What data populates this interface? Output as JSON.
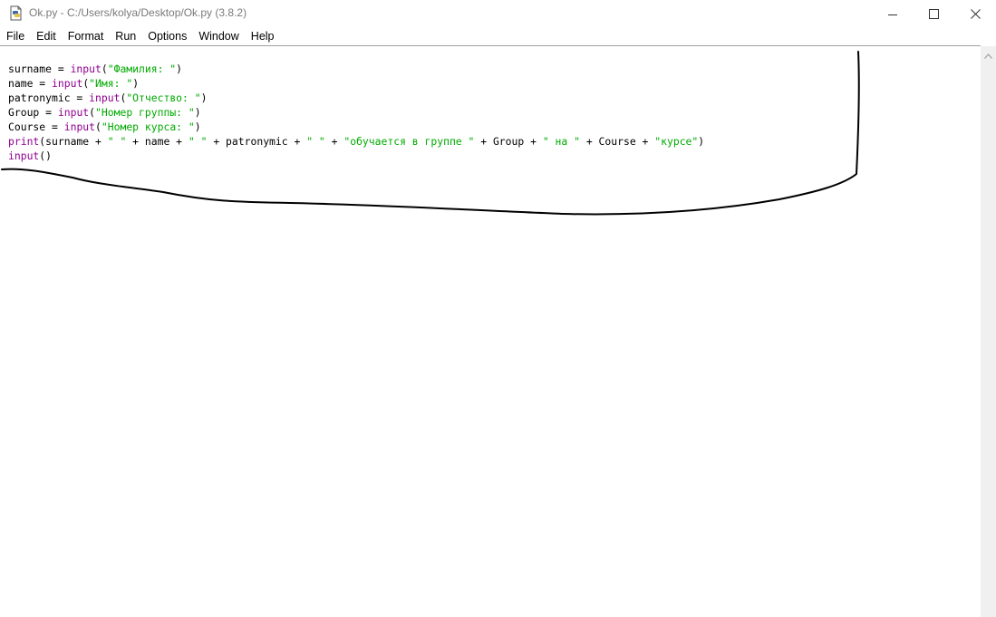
{
  "window": {
    "title": "Ok.py - C:/Users/kolya/Desktop/Ok.py (3.8.2)"
  },
  "icons": {
    "app": "python-file-icon",
    "minimize": "minimize-icon",
    "maximize": "maximize-icon",
    "close": "close-icon",
    "scroll_up": "arrow-up-icon"
  },
  "menu": {
    "items": [
      {
        "label": "File"
      },
      {
        "label": "Edit"
      },
      {
        "label": "Format"
      },
      {
        "label": "Run"
      },
      {
        "label": "Options"
      },
      {
        "label": "Window"
      },
      {
        "label": "Help"
      }
    ]
  },
  "code": {
    "lines": [
      [
        {
          "t": "surname = ",
          "c": "plain"
        },
        {
          "t": "input",
          "c": "kw"
        },
        {
          "t": "(",
          "c": "plain"
        },
        {
          "t": "\"Фамилия: \"",
          "c": "str"
        },
        {
          "t": ")",
          "c": "plain"
        }
      ],
      [
        {
          "t": "name = ",
          "c": "plain"
        },
        {
          "t": "input",
          "c": "kw"
        },
        {
          "t": "(",
          "c": "plain"
        },
        {
          "t": "\"Имя: \"",
          "c": "str"
        },
        {
          "t": ")",
          "c": "plain"
        }
      ],
      [
        {
          "t": "patronymic = ",
          "c": "plain"
        },
        {
          "t": "input",
          "c": "kw"
        },
        {
          "t": "(",
          "c": "plain"
        },
        {
          "t": "\"Отчество: \"",
          "c": "str"
        },
        {
          "t": ")",
          "c": "plain"
        }
      ],
      [
        {
          "t": "Group = ",
          "c": "plain"
        },
        {
          "t": "input",
          "c": "kw"
        },
        {
          "t": "(",
          "c": "plain"
        },
        {
          "t": "\"Номер группы: \"",
          "c": "str"
        },
        {
          "t": ")",
          "c": "plain"
        }
      ],
      [
        {
          "t": "Course = ",
          "c": "plain"
        },
        {
          "t": "input",
          "c": "kw"
        },
        {
          "t": "(",
          "c": "plain"
        },
        {
          "t": "\"Номер курса: \"",
          "c": "str"
        },
        {
          "t": ")",
          "c": "plain"
        }
      ],
      [
        {
          "t": "print",
          "c": "kw"
        },
        {
          "t": "(surname + ",
          "c": "plain"
        },
        {
          "t": "\" \"",
          "c": "str"
        },
        {
          "t": " + name + ",
          "c": "plain"
        },
        {
          "t": "\" \"",
          "c": "str"
        },
        {
          "t": " + patronymic + ",
          "c": "plain"
        },
        {
          "t": "\" \"",
          "c": "str"
        },
        {
          "t": " + ",
          "c": "plain"
        },
        {
          "t": "\"обучается в группе \"",
          "c": "str"
        },
        {
          "t": " + Group + ",
          "c": "plain"
        },
        {
          "t": "\" на \"",
          "c": "str"
        },
        {
          "t": " + Course + ",
          "c": "plain"
        },
        {
          "t": "\"курсе\"",
          "c": "str"
        },
        {
          "t": ")",
          "c": "plain"
        }
      ],
      [
        {
          "t": "input",
          "c": "kw"
        },
        {
          "t": "()",
          "c": "plain"
        }
      ]
    ]
  },
  "colors": {
    "keyword": "#900090",
    "string": "#00aa00",
    "annotation_stroke": "#000000"
  }
}
